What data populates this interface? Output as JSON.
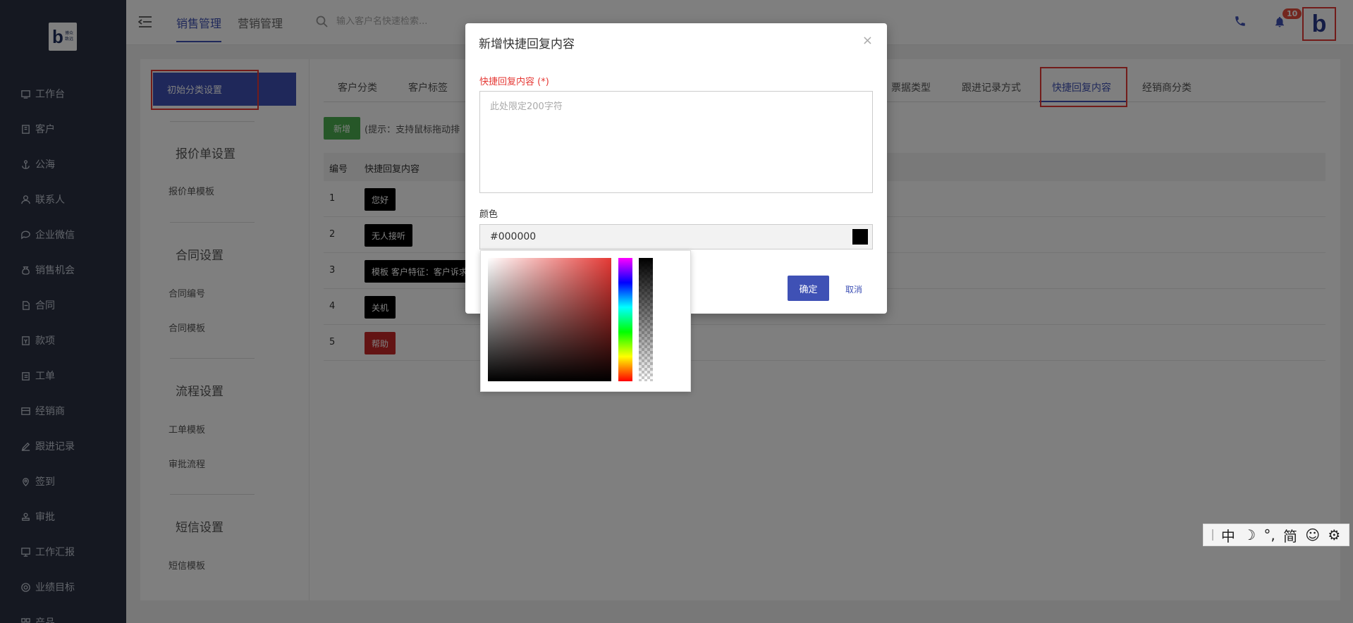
{
  "sidebar": {
    "logo": {
      "letter": "b",
      "text_line1": "博众",
      "text_line2": "致远"
    },
    "items": [
      {
        "label": "工作台",
        "icon": "monitor-icon"
      },
      {
        "label": "客户",
        "icon": "building-icon"
      },
      {
        "label": "公海",
        "icon": "anchor-icon"
      },
      {
        "label": "联系人",
        "icon": "person-icon"
      },
      {
        "label": "企业微信",
        "icon": "chat-icon"
      },
      {
        "label": "销售机会",
        "icon": "money-bag-icon"
      },
      {
        "label": "合同",
        "icon": "document-icon"
      },
      {
        "label": "款项",
        "icon": "ledger-icon"
      },
      {
        "label": "工单",
        "icon": "clipboard-icon"
      },
      {
        "label": "经销商",
        "icon": "store-icon"
      },
      {
        "label": "跟进记录",
        "icon": "edit-icon"
      },
      {
        "label": "签到",
        "icon": "location-icon"
      },
      {
        "label": "审批",
        "icon": "stamp-icon"
      },
      {
        "label": "工作汇报",
        "icon": "report-icon"
      },
      {
        "label": "业绩目标",
        "icon": "target-icon"
      },
      {
        "label": "产品",
        "icon": "grid-icon"
      }
    ]
  },
  "header": {
    "tabs": [
      "销售管理",
      "营销管理"
    ],
    "active_tab": 0,
    "search_placeholder": "输入客户名快速检索...",
    "notification_count": "10",
    "avatar_letter": "b"
  },
  "settings_nav": {
    "active_item": "初始分类设置",
    "groups": [
      {
        "title": "报价单设置",
        "items": [
          "报价单模板"
        ]
      },
      {
        "title": "合同设置",
        "items": [
          "合同编号",
          "合同模板"
        ]
      },
      {
        "title": "流程设置",
        "items": [
          "工单模板",
          "审批流程"
        ]
      },
      {
        "title": "短信设置",
        "items": [
          "短信模板"
        ]
      }
    ]
  },
  "content": {
    "tabs": [
      "客户分类",
      "客户标签",
      "票据类型",
      "跟进记录方式",
      "快捷回复内容",
      "经销商分类"
    ],
    "active_tab": "快捷回复内容",
    "add_button": "新增",
    "hint": "(提示：支持鼠标拖动排",
    "table": {
      "headers": [
        "编号",
        "快捷回复内容"
      ],
      "rows": [
        {
          "num": "1",
          "text": "您好",
          "color": "#000000"
        },
        {
          "num": "2",
          "text": "无人接听",
          "color": "#000000"
        },
        {
          "num": "3",
          "text": "模板 客户特征：客户诉求",
          "color": "#000000"
        },
        {
          "num": "4",
          "text": "关机",
          "color": "#000000"
        },
        {
          "num": "5",
          "text": "帮助",
          "color": "#c62828"
        }
      ]
    }
  },
  "modal": {
    "title": "新增快捷回复内容",
    "close": "×",
    "content_label": "快捷回复内容 (*)",
    "content_placeholder": "此处限定200字符",
    "color_label": "颜色",
    "color_value": "#000000",
    "ok_button": "确定",
    "cancel_button": "取消"
  },
  "ime_toolbar": {
    "items": [
      "中",
      "☽",
      "°,",
      "简",
      "☺",
      "⚙"
    ]
  },
  "colors": {
    "primary": "#3f51b5",
    "success": "#4caf50",
    "danger": "#e53935",
    "sidebar_bg": "#2a3142"
  }
}
